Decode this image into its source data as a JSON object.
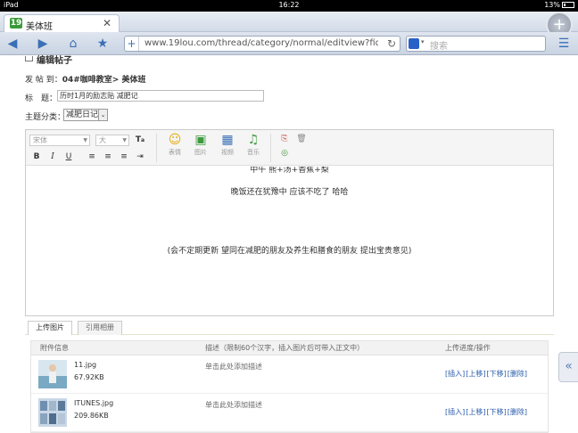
{
  "status": {
    "device": "iPad",
    "time": "16:22",
    "battery": "13%"
  },
  "tab": {
    "logo": "19",
    "title": "美体班",
    "close": "✕"
  },
  "toolbar": {
    "url": "www.19lou.com/thread/category/normal/editview?fid=1...",
    "search_placeholder": "搜索"
  },
  "form": {
    "heading": "编辑帖子",
    "post_to_label": "发 帖 到：",
    "post_to_value": "04#咖啡教室> 美体班",
    "title_label": "标　题：",
    "title_value": "历时1月的励志贴  减肥记",
    "category_label": "主题分类：",
    "category_value": "减肥日记"
  },
  "editor": {
    "font_select": "宋体",
    "size_select": "大",
    "icons": [
      {
        "name": "emoticon-icon",
        "label": "表情",
        "glyph": "☺",
        "color": "#e6a800"
      },
      {
        "name": "image-icon",
        "label": "图片",
        "glyph": "▣",
        "color": "#3d9a3d"
      },
      {
        "name": "video-icon",
        "label": "视频",
        "glyph": "▦",
        "color": "#3b6fb6"
      },
      {
        "name": "music-icon",
        "label": "音乐",
        "glyph": "♫",
        "color": "#3d9a3d"
      }
    ],
    "content": [
      "中午 熊+汤+香蕉+梨",
      "晚饭还在犹豫中 应该不吃了 哈哈",
      "(会不定期更新 望同在减肥的朋友及养生和膳食的朋友 提出宝贵意见)"
    ]
  },
  "upload": {
    "tabs": [
      "上传图片",
      "引用相册"
    ],
    "headers": [
      "附件信息",
      "描述（限制60个汉字，插入图片后可带入正文中）",
      "上传进度/操作"
    ],
    "files": [
      {
        "name": "11.jpg",
        "size": "67.92KB",
        "desc": "单击此处添加描述",
        "ops": [
          "[插入]",
          "[上移]",
          "[下移]",
          "[删除]"
        ]
      },
      {
        "name": "ITUNES.jpg",
        "size": "209.86KB",
        "desc": "单击此处添加描述",
        "ops": [
          "[插入]",
          "[上移]",
          "[下移]",
          "[删除]"
        ]
      }
    ]
  },
  "colors": {
    "link": "#2a5caa",
    "accent": "#3b6fb6"
  }
}
